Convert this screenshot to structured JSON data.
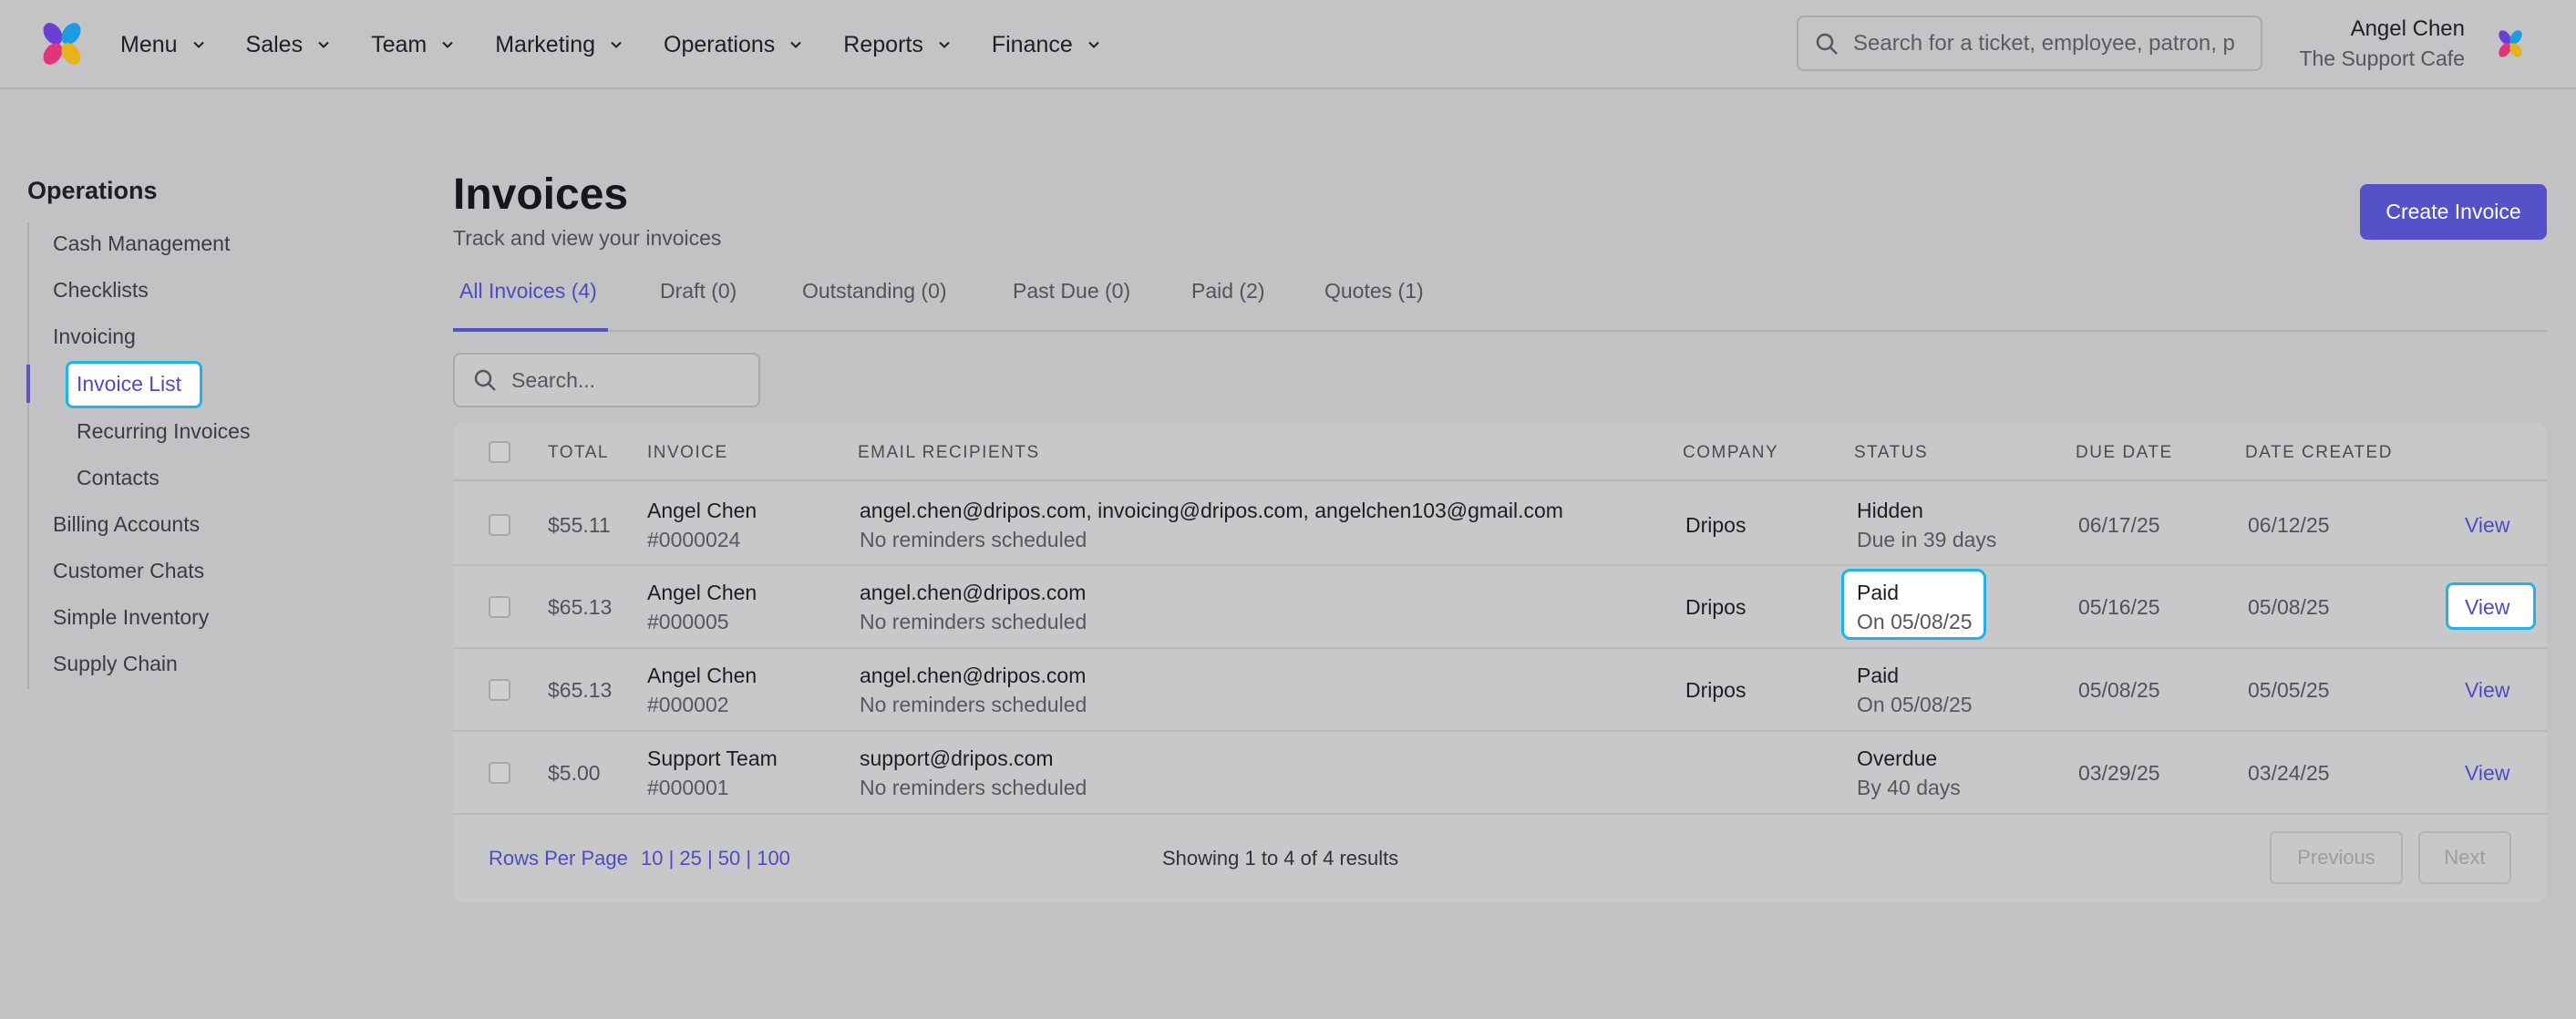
{
  "nav": {
    "items": [
      "Menu",
      "Sales",
      "Team",
      "Marketing",
      "Operations",
      "Reports",
      "Finance"
    ],
    "search_placeholder": "Search for a ticket, employee, patron, p",
    "user_name": "Angel Chen",
    "user_org": "The Support Cafe"
  },
  "sidebar": {
    "title": "Operations",
    "items": {
      "cash": "Cash Management",
      "checklists": "Checklists",
      "invoicing": "Invoicing",
      "invoice_list": "Invoice List",
      "recurring": "Recurring Invoices",
      "contacts": "Contacts",
      "billing": "Billing Accounts",
      "chats": "Customer Chats",
      "inventory": "Simple Inventory",
      "supply": "Supply Chain"
    }
  },
  "page": {
    "title": "Invoices",
    "subtitle": "Track and view your invoices",
    "create_label": "Create Invoice"
  },
  "tabs": [
    "All Invoices (4)",
    "Draft (0)",
    "Outstanding (0)",
    "Past Due (0)",
    "Paid (2)",
    "Quotes (1)"
  ],
  "table_search_placeholder": "Search...",
  "table": {
    "headers": [
      "TOTAL",
      "INVOICE",
      "EMAIL RECIPIENTS",
      "COMPANY",
      "STATUS",
      "DUE DATE",
      "DATE CREATED"
    ],
    "rows": [
      {
        "total": "$55.11",
        "name": "Angel Chen",
        "number": "#0000024",
        "emails": "angel.chen@dripos.com, invoicing@dripos.com, angelchen103@gmail.com",
        "reminder": "No reminders scheduled",
        "company": "Dripos",
        "status": "Hidden",
        "status_sub": "Due in 39 days",
        "due": "06/17/25",
        "created": "06/12/25",
        "action": "View"
      },
      {
        "total": "$65.13",
        "name": "Angel Chen",
        "number": "#000005",
        "emails": "angel.chen@dripos.com",
        "reminder": "No reminders scheduled",
        "company": "Dripos",
        "status": "Paid",
        "status_sub": "On 05/08/25",
        "due": "05/16/25",
        "created": "05/08/25",
        "action": "View"
      },
      {
        "total": "$65.13",
        "name": "Angel Chen",
        "number": "#000002",
        "emails": "angel.chen@dripos.com",
        "reminder": "No reminders scheduled",
        "company": "Dripos",
        "status": "Paid",
        "status_sub": "On 05/08/25",
        "due": "05/08/25",
        "created": "05/05/25",
        "action": "View"
      },
      {
        "total": "$5.00",
        "name": "Support Team",
        "number": "#000001",
        "emails": "support@dripos.com",
        "reminder": "No reminders scheduled",
        "company": "",
        "status": "Overdue",
        "status_sub": "By 40 days",
        "due": "03/29/25",
        "created": "03/24/25",
        "action": "View"
      }
    ]
  },
  "footer": {
    "rows_per_page": "Rows Per Page",
    "page_sizes": "10 | 25 | 50 | 100",
    "showing": "Showing 1 to 4 of 4 results",
    "previous": "Previous",
    "next": "Next"
  }
}
